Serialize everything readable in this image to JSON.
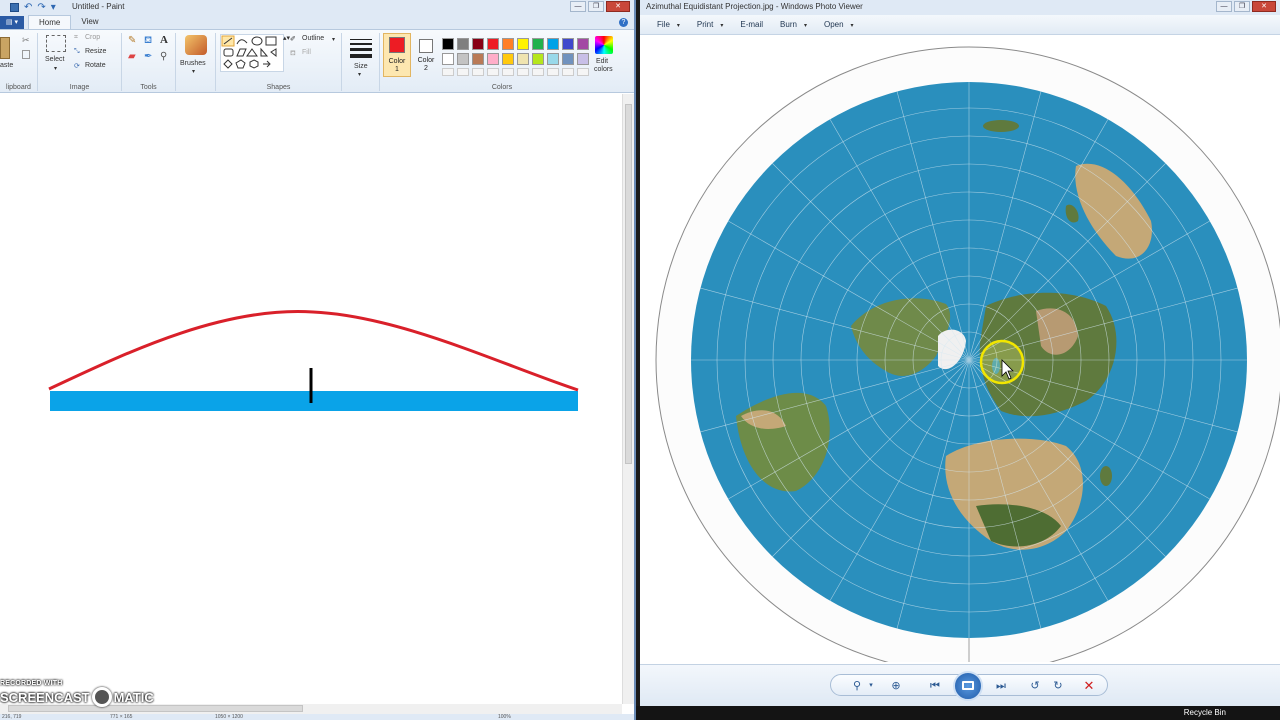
{
  "paint": {
    "title": "Untitled - Paint",
    "app_menu": "▤ ▾",
    "tabs": [
      "Home",
      "View"
    ],
    "groups": {
      "clipboard": {
        "label": "lipboard",
        "paste": "aste"
      },
      "image": {
        "label": "Image",
        "select": "Select",
        "crop": "Crop",
        "resize": "Resize",
        "rotate": "Rotate"
      },
      "tools": {
        "label": "Tools"
      },
      "brushes": {
        "label": "Brushes"
      },
      "shapes": {
        "label": "Shapes",
        "outline": "Outline",
        "fill": "Fill"
      },
      "size": {
        "label": "Size"
      },
      "colors": {
        "label": "Colors",
        "color1": [
          "Color",
          "1"
        ],
        "color2": [
          "Color",
          "2"
        ],
        "edit": [
          "Edit",
          "colors"
        ],
        "palette_row1": [
          "#000000",
          "#7f7f7f",
          "#880015",
          "#ed1c24",
          "#ff7f27",
          "#fff200",
          "#22b14c",
          "#00a2e8",
          "#3f48cc",
          "#a349a4"
        ],
        "palette_row2": [
          "#ffffff",
          "#c3c3c3",
          "#b97a57",
          "#ffaec9",
          "#ffc90e",
          "#efe4b0",
          "#b5e61d",
          "#99d9ea",
          "#7092be",
          "#c8bfe7"
        ],
        "color1_value": "#ed1c24",
        "color2_value": "#ffffff"
      }
    },
    "drawing": {
      "arc_color": "#d9202a",
      "bar_color": "#0aa3e8",
      "marker_color": "#000000"
    },
    "status": {
      "pos": "216, 719",
      "sel": "771 × 165",
      "size": "1050 × 1200",
      "zoom": "100%"
    }
  },
  "watermark": {
    "line1": "RECORDED WITH",
    "line2a": "SCREENCAST",
    "line2b": "MATIC"
  },
  "viewer": {
    "title": "Azimuthal Equidistant Projection.jpg - Windows Photo Viewer",
    "menu": [
      "File",
      "Print",
      "E-mail",
      "Burn",
      "Open"
    ],
    "controls": {
      "zoom": "⚲",
      "fit": "⊕",
      "prev": "⏮",
      "next": "⏭",
      "rotate_ccw": "↺",
      "rotate_cw": "↻",
      "delete": "✕"
    }
  },
  "taskbar": {
    "recycle_bin": "Recycle Bin"
  }
}
